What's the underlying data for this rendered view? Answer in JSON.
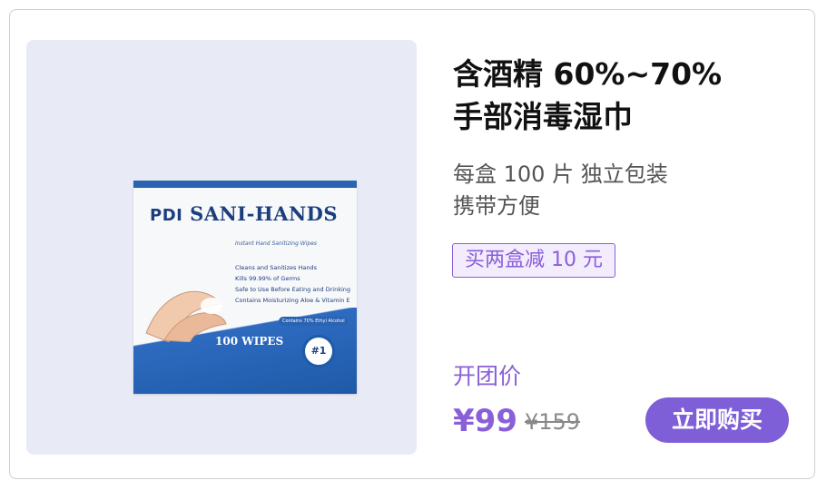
{
  "product": {
    "title_line1": "含酒精 60%~70%",
    "title_line2": "手部消毒湿巾",
    "desc_line1": "每盒 100 片 独立包装",
    "desc_line2": "携带方便",
    "promo": "买两盒减 10 元",
    "group_label": "开团价",
    "price": "¥99",
    "original_price": "¥159",
    "buy_label": "立即购买",
    "image": {
      "brand_mark": "PDI",
      "brand_name": "SANI-HANDS",
      "subtitle": "Instant Hand Sanitizing Wipes",
      "bullets": [
        "Cleans and Sanitizes Hands",
        "Kills 99.99% of Germs",
        "Safe to Use Before Eating and Drinking",
        "Contains Moisturizing Aloe & Vitamin E"
      ],
      "alcohol_note": "Contains 70% Ethyl Alcohol",
      "count": "100 WIPES",
      "seal": "#1"
    }
  },
  "colors": {
    "accent": "#8a5fd9",
    "button": "#7f5fd8",
    "panel_bg": "#e8ebf6",
    "box_blue": "#1f5aa8"
  }
}
